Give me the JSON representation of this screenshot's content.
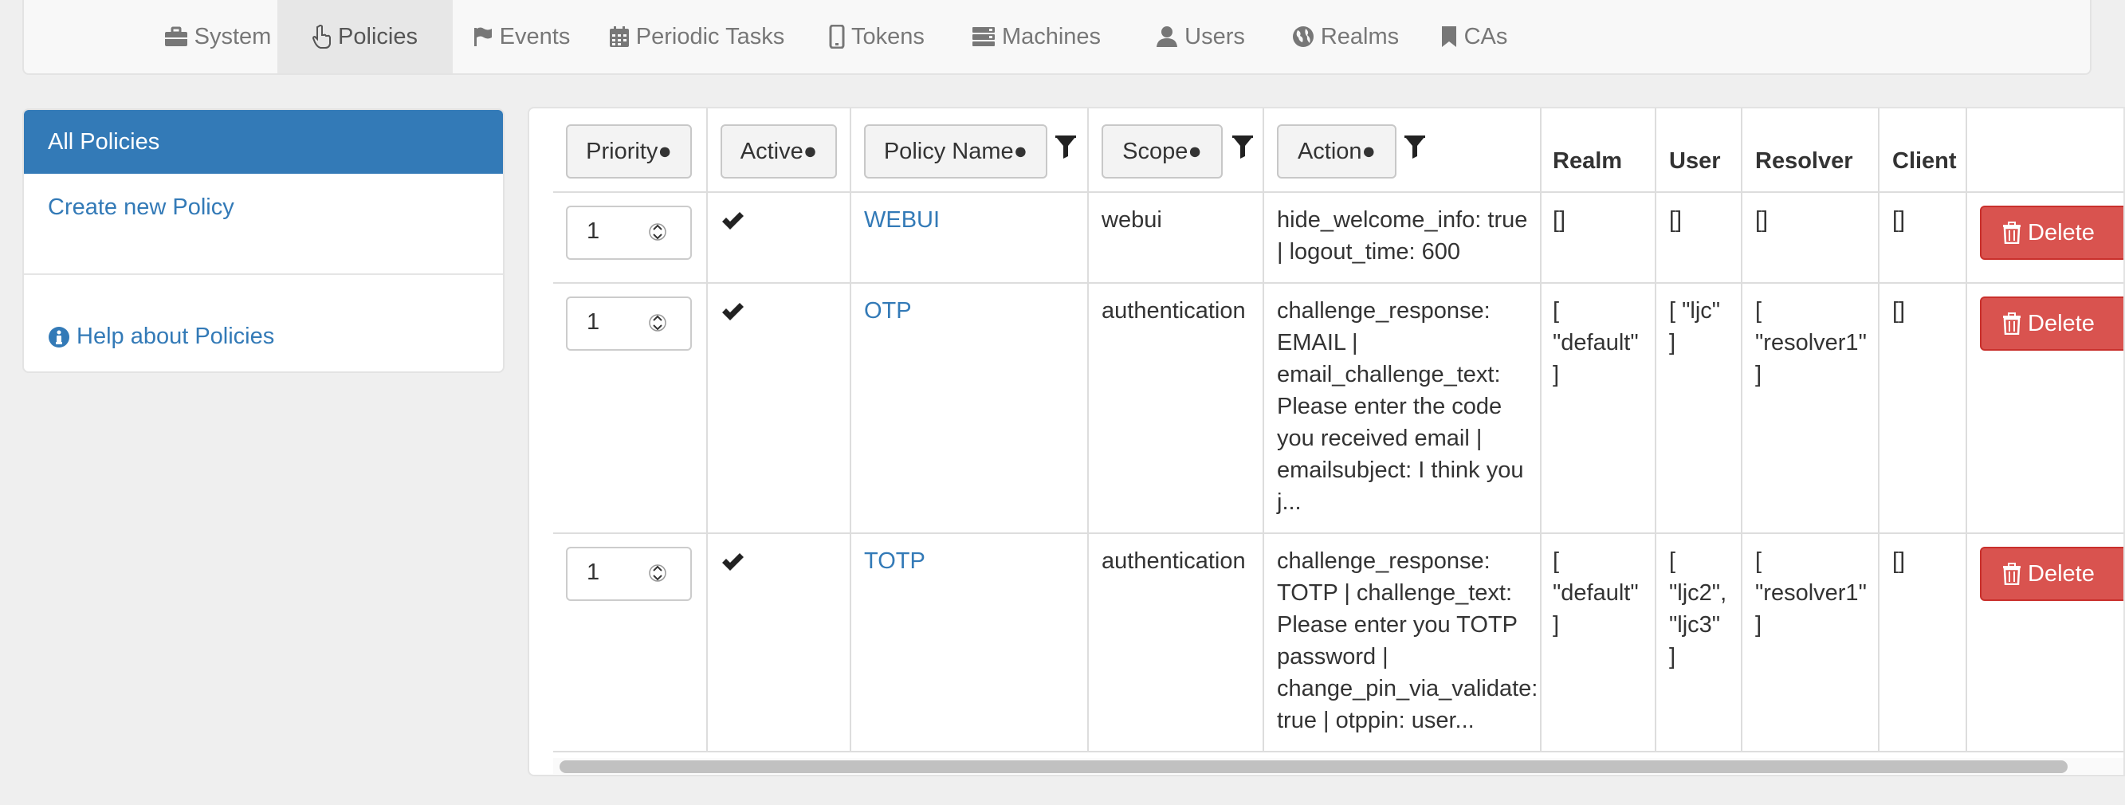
{
  "nav": {
    "items": [
      {
        "label": "System",
        "icon": "briefcase-icon"
      },
      {
        "label": "Policies",
        "icon": "hand-pointer-icon",
        "active": true
      },
      {
        "label": "Events",
        "icon": "flag-icon"
      },
      {
        "label": "Periodic Tasks",
        "icon": "calendar-icon"
      },
      {
        "label": "Tokens",
        "icon": "mobile-icon"
      },
      {
        "label": "Machines",
        "icon": "server-icon"
      },
      {
        "label": "Users",
        "icon": "user-icon"
      },
      {
        "label": "Realms",
        "icon": "globe-icon"
      },
      {
        "label": "CAs",
        "icon": "bookmark-icon"
      }
    ]
  },
  "sidebar": {
    "active_label": "All Policies",
    "create_label": "Create new Policy",
    "help_label": "Help about Policies"
  },
  "table": {
    "headers": {
      "priority": "Priority●",
      "active": "Active●",
      "policy_name": "Policy Name●",
      "scope": "Scope●",
      "action": "Action●",
      "realm": "Realm",
      "user": "User",
      "resolver": "Resolver",
      "client": "Client"
    },
    "rows": [
      {
        "priority": "1",
        "name": "WEBUI",
        "scope": "webui",
        "action": [
          "hide_welcome_info: true",
          "| logout_time: 600"
        ],
        "realm": [
          "[]"
        ],
        "user": [
          "[]"
        ],
        "resolver": [
          "[]"
        ],
        "client": "[]",
        "delete_label": "Delete"
      },
      {
        "priority": "1",
        "name": "OTP",
        "scope": "authentication",
        "action": [
          "challenge_response:",
          "EMAIL |",
          "email_challenge_text:",
          "Please enter the code",
          "you received email |",
          "emailsubject: I think you",
          "j..."
        ],
        "realm": [
          "[",
          "\"default\"",
          "]"
        ],
        "user": [
          "[ \"ljc\"",
          "]"
        ],
        "resolver": [
          "[",
          "\"resolver1\"",
          "]"
        ],
        "client": "[]",
        "delete_label": "Delete"
      },
      {
        "priority": "1",
        "name": "TOTP",
        "scope": "authentication",
        "action": [
          "challenge_response:",
          "TOTP | challenge_text:",
          "Please enter you TOTP",
          "password |",
          "change_pin_via_validate:",
          "true | otppin: user..."
        ],
        "realm": [
          "[",
          "\"default\"",
          "]"
        ],
        "user": [
          "[",
          "\"ljc2\",",
          "\"ljc3\"",
          "]"
        ],
        "resolver": [
          "[",
          "\"resolver1\"",
          "]"
        ],
        "client": "[]",
        "delete_label": "Delete"
      }
    ]
  },
  "colors": {
    "primary": "#337ab7",
    "danger": "#d9534f",
    "background": "#efefef"
  }
}
